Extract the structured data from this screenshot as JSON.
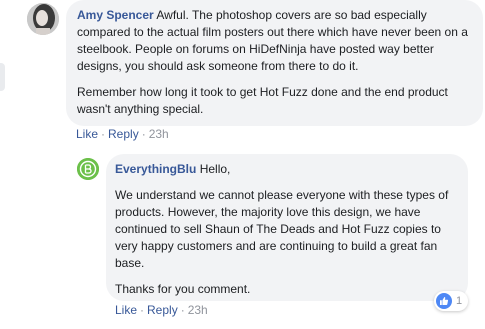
{
  "comment": {
    "author": "Amy Spencer",
    "paragraphs": [
      "Awful. The photoshop covers are so bad especially compared to the actual film posters out there which have never been on a steelbook. People on forums on HiDefNinja have posted way better designs, you should ask someone from there to do it.",
      "Remember how long it took to get Hot Fuzz done and the end product wasn't anything special."
    ],
    "actions": {
      "like": "Like",
      "reply": "Reply",
      "time": "23h"
    }
  },
  "reply": {
    "author": "EverythingBlu",
    "greeting": "Hello,",
    "paragraphs": [
      "We understand we cannot please everyone with these types of products. However, the majority love this design, we have continued to sell Shaun of The Deads and Hot Fuzz copies to very happy customers and are continuing to build a great fan base.",
      "Thanks for you comment."
    ],
    "actions": {
      "like": "Like",
      "reply": "Reply",
      "time": "23h"
    },
    "reactions": {
      "icon": "like-icon",
      "count": "1"
    }
  },
  "colors": {
    "author_link": "#385898",
    "bubble_bg": "#f2f3f5",
    "meta_gray": "#90949c",
    "brand_green": "#6cc04a",
    "like_blue": "#4e88f5"
  }
}
